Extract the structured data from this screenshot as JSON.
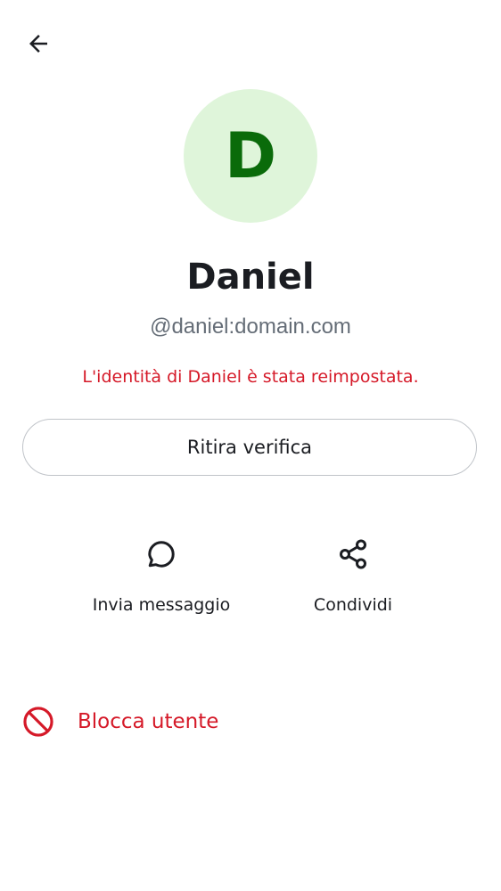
{
  "header": {
    "back_icon": "arrow-left-icon"
  },
  "profile": {
    "avatar_letter": "D",
    "avatar_bg": "#dff5da",
    "avatar_fg": "#0a6b0a",
    "name": "Daniel",
    "user_id": "@daniel:domain.com",
    "warning": "L'identità di Daniel è stata reimpostata."
  },
  "buttons": {
    "withdraw_verification": "Ritira verifica"
  },
  "actions": {
    "message": {
      "label": "Invia messaggio",
      "icon": "chat-bubble-icon"
    },
    "share": {
      "label": "Condividi",
      "icon": "share-icon"
    }
  },
  "block": {
    "label": "Blocca utente",
    "icon": "block-icon",
    "color": "#d51928"
  }
}
